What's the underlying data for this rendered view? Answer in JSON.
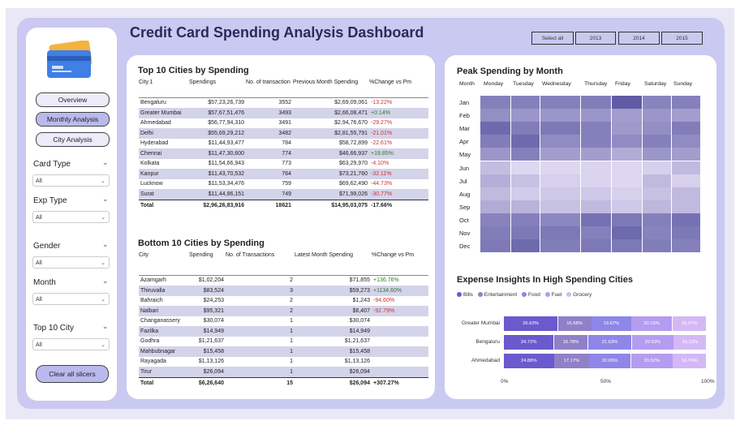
{
  "title": "Credit Card Spending Analysis Dashboard",
  "slicers": [
    "Select all",
    "2013",
    "2014",
    "2015"
  ],
  "nav": [
    "Overview",
    "Monthly Analysis",
    "City Analysis"
  ],
  "filters": [
    {
      "label": "Card Type",
      "value": "All"
    },
    {
      "label": "Exp Type",
      "value": "All"
    },
    {
      "label": "Gender",
      "value": "All"
    },
    {
      "label": "Month",
      "value": "All"
    },
    {
      "label": "Top 10 City",
      "value": "All"
    }
  ],
  "clear_label": "Clear all slicers",
  "top10": {
    "title": "Top 10 Cities by Spending",
    "headers": [
      "City.1",
      "Spendings",
      "No. of transaction",
      "Previous Month Spending",
      "%Change vs Pm"
    ],
    "rows": [
      [
        "Bengaluru",
        "$57,23,26,739",
        "3552",
        "$2,69,09,061",
        "-13.22%"
      ],
      [
        "Greater Mumbai",
        "$57,67,51,476",
        "3493",
        "$2,66,08,471",
        "+0.14%"
      ],
      [
        "Ahmedabad",
        "$56,77,94,310",
        "3491",
        "$2,94,76,670",
        "-29.27%"
      ],
      [
        "Delhi",
        "$55,69,29,212",
        "3482",
        "$2,81,55,791",
        "-21.01%"
      ],
      [
        "Hyderabad",
        "$11,44,93,477",
        "784",
        "$58,72,899",
        "-22.61%"
      ],
      [
        "Chennai",
        "$11,47,30,600",
        "774",
        "$46,66,937",
        "+19.85%"
      ],
      [
        "Kolkata",
        "$11,54,66,943",
        "773",
        "$63,29,970",
        "-4.10%"
      ],
      [
        "Kanpur",
        "$11,43,70,532",
        "764",
        "$73,21,760",
        "-32.11%"
      ],
      [
        "Lucknow",
        "$11,53,34,476",
        "759",
        "$69,62,490",
        "-44.73%"
      ],
      [
        "Surat",
        "$11,44,86,151",
        "749",
        "$71,99,026",
        "-30.77%"
      ]
    ],
    "total": [
      "Total",
      "$2,96,26,83,916",
      "18621",
      "$14,95,03,075",
      "-17.66%"
    ]
  },
  "bottom10": {
    "title": "Bottom 10 Cities by Spending",
    "headers": [
      "City",
      "Spending",
      "No. of Transactions",
      "Latest Month Spending",
      "%Change vs Pm"
    ],
    "rows": [
      [
        "Azamgarh",
        "$1,02,204",
        "2",
        "$71,855",
        "+136.76%"
      ],
      [
        "Thiruvalla",
        "$83,524",
        "3",
        "$59,273",
        "+1134.60%"
      ],
      [
        "Bahraich",
        "$24,253",
        "2",
        "$1,243",
        "-94.60%"
      ],
      [
        "Nalbari",
        "$95,321",
        "2",
        "$6,407",
        "-92.79%"
      ],
      [
        "Changanassery",
        "$30,074",
        "1",
        "$30,074",
        ""
      ],
      [
        "Fazilka",
        "$14,949",
        "1",
        "$14,949",
        ""
      ],
      [
        "Godhra",
        "$1,21,637",
        "1",
        "$1,21,637",
        ""
      ],
      [
        "Mahbubnagar",
        "$15,458",
        "1",
        "$15,458",
        ""
      ],
      [
        "Rayagada",
        "$1,13,126",
        "1",
        "$1,13,126",
        ""
      ],
      [
        "Tirur",
        "$26,094",
        "1",
        "$26,094",
        ""
      ]
    ],
    "total": [
      "Total",
      "$6,26,640",
      "15",
      "$26,094",
      "+307.27%"
    ]
  },
  "peak": {
    "title": "Peak Spending by Month",
    "corner": "Month",
    "days": [
      "Monday",
      "Tuesday",
      "Wednesday",
      "Thursday",
      "Friday",
      "Saturday",
      "Sunday"
    ],
    "months": [
      "Jan",
      "Feb",
      "Mar",
      "Apr",
      "May",
      "Jun",
      "Jul",
      "Aug",
      "Sep",
      "Oct",
      "Nov",
      "Dec"
    ],
    "intensity": [
      [
        0.7,
        0.7,
        0.7,
        0.72,
        0.95,
        0.68,
        0.7
      ],
      [
        0.6,
        0.55,
        0.55,
        0.55,
        0.5,
        0.55,
        0.5
      ],
      [
        0.85,
        0.72,
        0.75,
        0.7,
        0.52,
        0.6,
        0.72
      ],
      [
        0.72,
        0.85,
        0.62,
        0.7,
        0.62,
        0.7,
        0.62
      ],
      [
        0.55,
        0.7,
        0.5,
        0.5,
        0.4,
        0.55,
        0.5
      ],
      [
        0.28,
        0.1,
        0.1,
        0.12,
        0.1,
        0.15,
        0.3
      ],
      [
        0.38,
        0.25,
        0.15,
        0.12,
        0.1,
        0.3,
        0.15
      ],
      [
        0.3,
        0.18,
        0.2,
        0.2,
        0.15,
        0.25,
        0.3
      ],
      [
        0.4,
        0.35,
        0.25,
        0.3,
        0.2,
        0.32,
        0.3
      ],
      [
        0.68,
        0.7,
        0.65,
        0.8,
        0.75,
        0.7,
        0.8
      ],
      [
        0.72,
        0.75,
        0.75,
        0.7,
        0.85,
        0.68,
        0.75
      ],
      [
        0.75,
        0.85,
        0.72,
        0.75,
        0.75,
        0.72,
        0.7
      ]
    ]
  },
  "expense": {
    "title": "Expense Insights In High Spending Cities",
    "legend": [
      "Bills",
      "Entertainment",
      "Food",
      "Fuel",
      "Grocery"
    ],
    "colors": [
      "#6a5acd",
      "#9080c8",
      "#8e86e8",
      "#b49cf0",
      "#d4b8f6"
    ],
    "axis": [
      "0%",
      "50%",
      "100%"
    ],
    "chart_data": {
      "type": "bar",
      "categories": [
        "Greater Mumbai",
        "Bengaluru",
        "Ahmedabad"
      ],
      "series": [
        {
          "name": "Bills",
          "values": [
            26.63,
            24.72,
            24.88
          ]
        },
        {
          "name": "Entertainment",
          "values": [
            16.58,
            16.78,
            17.17
          ]
        },
        {
          "name": "Food",
          "values": [
            19.67,
            21.63,
            20.69
          ]
        },
        {
          "name": "Fuel",
          "values": [
            20.15,
            20.63,
            20.52
          ]
        },
        {
          "name": "Grocery",
          "values": [
            16.97,
            16.23,
            16.74
          ]
        }
      ],
      "labels": [
        [
          "26.63%",
          "16.58%",
          "19.67%",
          "20.15%",
          "16.97%"
        ],
        [
          "24.72%",
          "16.78%",
          "21.63%",
          "20.63%",
          "16.23%"
        ],
        [
          "24.88%",
          "17.17%",
          "20.69%",
          "20.52%",
          "16.74%"
        ]
      ]
    }
  }
}
